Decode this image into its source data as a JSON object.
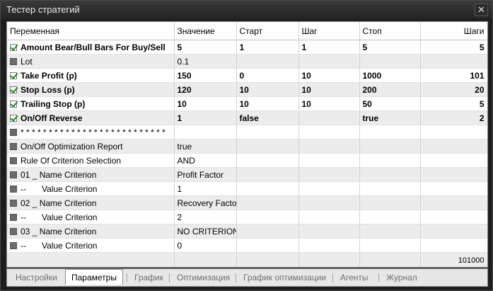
{
  "window": {
    "title": "Тестер стратегий",
    "close_icon": "close-icon"
  },
  "table": {
    "headers": [
      "Переменная",
      "Значение",
      "Старт",
      "Шаг",
      "Стоп",
      "Шаги"
    ],
    "rows": [
      {
        "checked": true,
        "name": "Amount Bear/Bull Bars For Buy/Sell",
        "value": "5",
        "start": "1",
        "step": "1",
        "stop": "5",
        "steps": "5"
      },
      {
        "checked": false,
        "name": "Lot",
        "value": "0.1",
        "start": "",
        "step": "",
        "stop": "",
        "steps": ""
      },
      {
        "checked": true,
        "name": "Take Profit (p)",
        "value": "150",
        "start": "0",
        "step": "10",
        "stop": "1000",
        "steps": "101"
      },
      {
        "checked": true,
        "name": "Stop Loss (p)",
        "value": "120",
        "start": "10",
        "step": "10",
        "stop": "200",
        "steps": "20"
      },
      {
        "checked": true,
        "name": "Trailing Stop (p)",
        "value": "10",
        "start": "10",
        "step": "10",
        "stop": "50",
        "steps": "5"
      },
      {
        "checked": true,
        "name": "On/Off Reverse",
        "value": "1",
        "start": "false",
        "step": "",
        "stop": "true",
        "steps": "2"
      },
      {
        "checked": false,
        "name": "* * * * * * * * * * * * * * * * * * * * * * * * * *",
        "value": "",
        "start": "",
        "step": "",
        "stop": "",
        "steps": ""
      },
      {
        "checked": false,
        "name": "On/Off Optimization Report",
        "value": "true",
        "start": "",
        "step": "",
        "stop": "",
        "steps": ""
      },
      {
        "checked": false,
        "name": "Rule Of Criterion Selection",
        "value": "AND",
        "start": "",
        "step": "",
        "stop": "",
        "steps": ""
      },
      {
        "checked": false,
        "name": "01 _ Name Criterion",
        "value": "Profit Factor",
        "start": "",
        "step": "",
        "stop": "",
        "steps": ""
      },
      {
        "checked": false,
        "prefix": "--",
        "name": "Value Criterion",
        "value": "1",
        "start": "",
        "step": "",
        "stop": "",
        "steps": ""
      },
      {
        "checked": false,
        "name": "02 _ Name Criterion",
        "value": "Recovery Factor",
        "start": "",
        "step": "",
        "stop": "",
        "steps": ""
      },
      {
        "checked": false,
        "prefix": "--",
        "name": "Value Criterion",
        "value": "2",
        "start": "",
        "step": "",
        "stop": "",
        "steps": ""
      },
      {
        "checked": false,
        "name": "03 _ Name Criterion",
        "value": "NO CRITERION",
        "start": "",
        "step": "",
        "stop": "",
        "steps": ""
      },
      {
        "checked": false,
        "prefix": "--",
        "name": "Value Criterion",
        "value": "0",
        "start": "",
        "step": "",
        "stop": "",
        "steps": ""
      }
    ],
    "total_steps": "101000"
  },
  "tabs": [
    {
      "label": "Настройки",
      "active": false
    },
    {
      "label": "Параметры",
      "active": true
    },
    {
      "label": "График",
      "active": false
    },
    {
      "label": "Оптимизация",
      "active": false
    },
    {
      "label": "График оптимизации",
      "active": false
    },
    {
      "label": "Агенты",
      "active": false
    },
    {
      "label": "Журнал",
      "active": false
    }
  ]
}
